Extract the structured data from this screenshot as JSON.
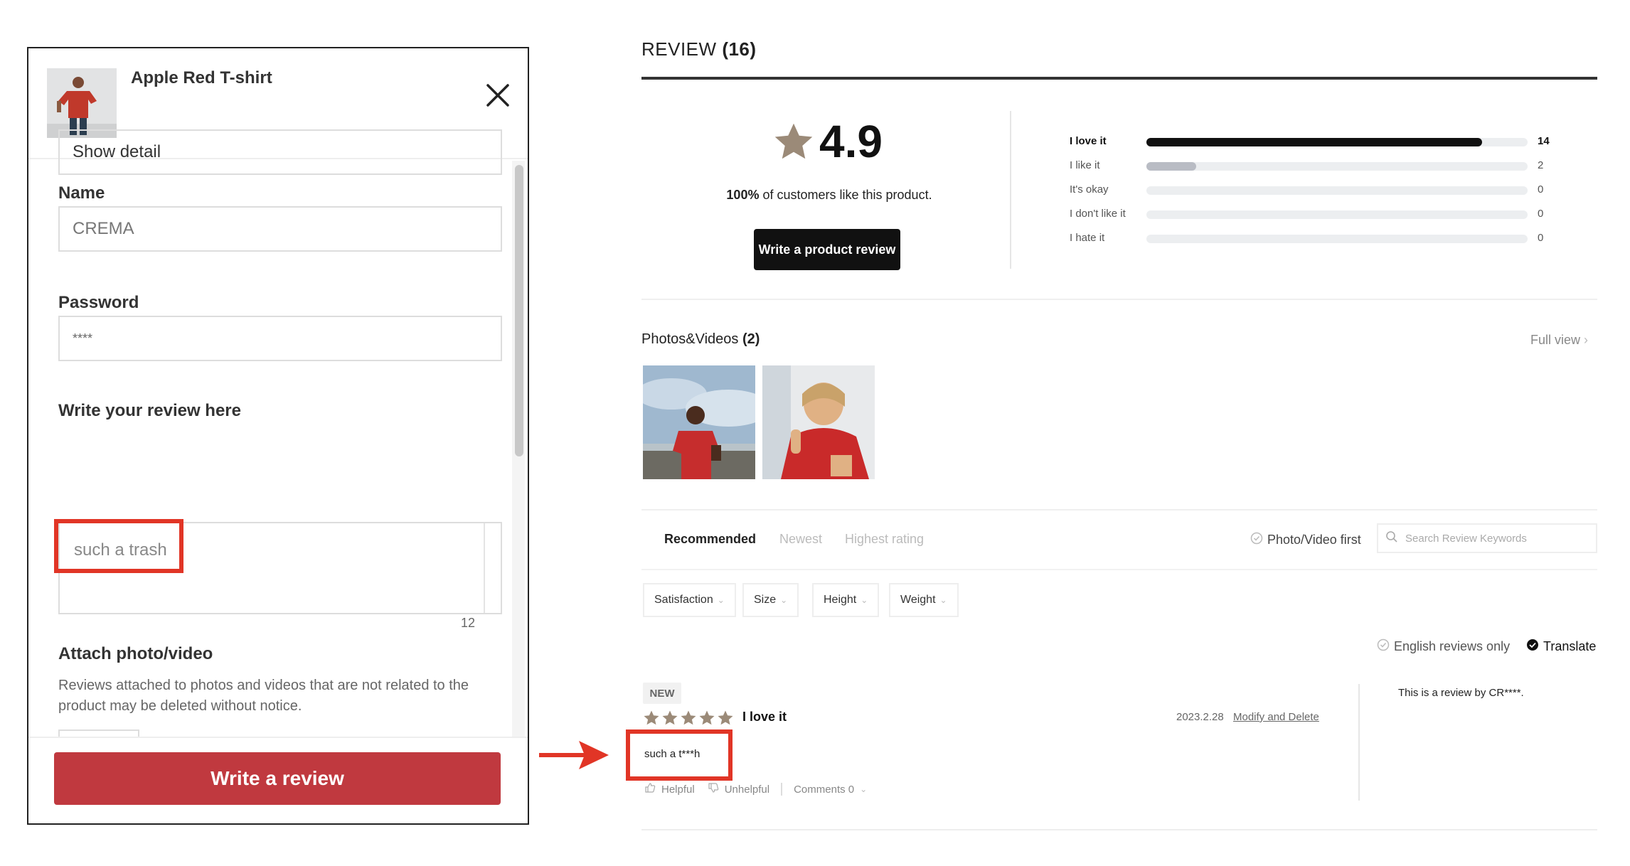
{
  "modal": {
    "product_name": "Apple Red T-shirt",
    "show_detail": "Show detail",
    "name_label": "Name",
    "name_value": "CREMA",
    "password_label": "Password",
    "password_value": "****",
    "review_label": "Write your review here",
    "review_value": "such a trash",
    "char_count": "12",
    "attach_label": "Attach photo/video",
    "attach_notice": "Reviews attached to photos and videos that are not related to the product may be deleted without notice.",
    "submit_label": "Write a review"
  },
  "review": {
    "title": "REVIEW",
    "count": "(16)",
    "rating": "4.9",
    "like_pct": "100%",
    "like_text": " of customers like this product.",
    "write_button": "Write a product review",
    "distribution": [
      {
        "label": "I love it",
        "count": "14",
        "fraction": 0.88
      },
      {
        "label": "I like it",
        "count": "2",
        "fraction": 0.13
      },
      {
        "label": "It's okay",
        "count": "0",
        "fraction": 0
      },
      {
        "label": "I don't like it",
        "count": "0",
        "fraction": 0
      },
      {
        "label": "I hate it",
        "count": "0",
        "fraction": 0
      }
    ],
    "photos_label": "Photos&Videos",
    "photos_count": "(2)",
    "full_view": "Full view",
    "sort": {
      "recommended": "Recommended",
      "newest": "Newest",
      "highest": "Highest rating"
    },
    "photo_first": "Photo/Video first",
    "search_placeholder": "Search Review Keywords",
    "filters": {
      "satisfaction": "Satisfaction",
      "size": "Size",
      "height": "Height",
      "weight": "Weight"
    },
    "english_only": "English reviews only",
    "translate": "Translate",
    "item": {
      "badge": "NEW",
      "stars": 5,
      "headline": "I love it",
      "date": "2023.2.28",
      "modify": "Modify and Delete",
      "text": "such a t***h",
      "helpful": "Helpful",
      "unhelpful": "Unhelpful",
      "comments": "Comments 0",
      "reviewer_note": "This is a review by CR****."
    }
  },
  "colors": {
    "accent_red": "#c0393f",
    "highlight_red": "#e13526",
    "star": "#9b8a78",
    "bar_dark": "#111111",
    "bar_light": "#b9bcc4"
  }
}
